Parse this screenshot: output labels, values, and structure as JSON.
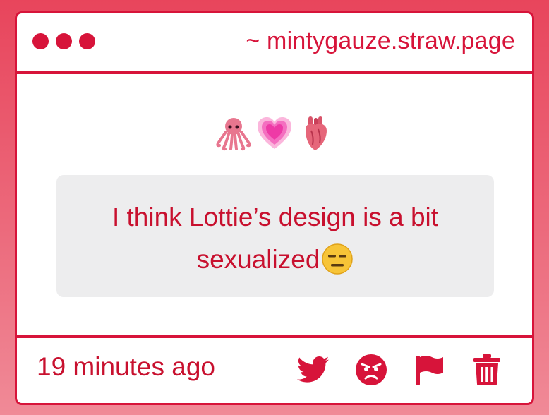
{
  "window": {
    "url": "~ mintygauze.straw.page",
    "accent_color": "#d7143a"
  },
  "message": {
    "emojis": [
      "octopus-emoji",
      "growing-heart-emoji",
      "anatomical-heart-emoji"
    ],
    "text": "I think Lottie’s design is a bit sexualized",
    "trailing_emoji": "expressionless-face-emoji"
  },
  "footer": {
    "timestamp": "19 minutes ago",
    "actions": [
      "twitter-icon",
      "angry-face-icon",
      "flag-icon",
      "trash-icon"
    ]
  }
}
